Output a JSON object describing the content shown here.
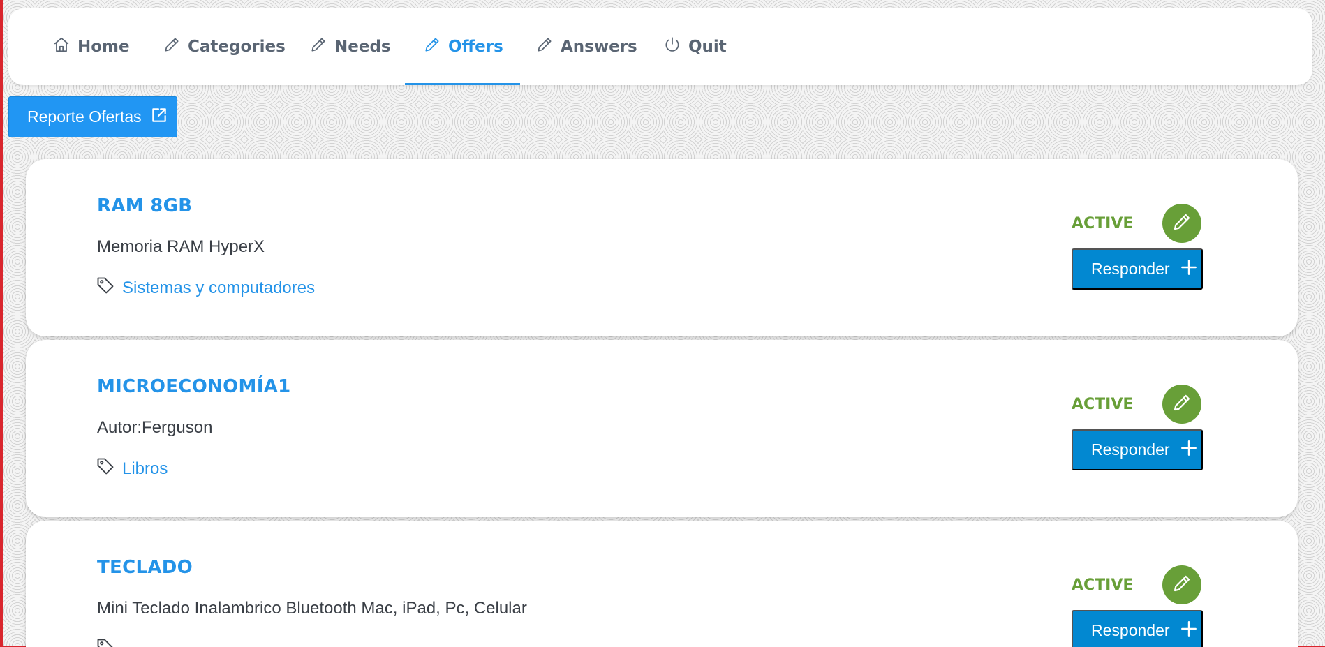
{
  "nav": {
    "items": [
      {
        "label": "Home",
        "icon": "home-icon",
        "active": false
      },
      {
        "label": "Categories",
        "icon": "pencil-icon",
        "active": false
      },
      {
        "label": "Needs",
        "icon": "pencil-icon",
        "active": false
      },
      {
        "label": "Offers",
        "icon": "pencil-icon",
        "active": true
      },
      {
        "label": "Answers",
        "icon": "pencil-icon",
        "active": false
      },
      {
        "label": "Quit",
        "icon": "power-icon",
        "active": false
      }
    ]
  },
  "report": {
    "label": "Reporte Ofertas",
    "icon": "external-link-icon"
  },
  "offers": [
    {
      "title": "RAM 8GB",
      "description": "Memoria RAM HyperX",
      "category": "Sistemas y computadores",
      "status": "ACTIVE",
      "respond_label": "Responder"
    },
    {
      "title": "MICROECONOMÍA1",
      "description": "Autor:Ferguson",
      "category": "Libros",
      "status": "ACTIVE",
      "respond_label": "Responder"
    },
    {
      "title": "TECLADO",
      "description": "Mini Teclado Inalambrico Bluetooth Mac, iPad, Pc, Celular",
      "category": "",
      "status": "ACTIVE",
      "respond_label": "Responder"
    }
  ],
  "colors": {
    "accent": "#2493e8",
    "status_active": "#689f38",
    "respond_button": "#0288d1",
    "report_button": "#2196f3",
    "nav_text": "#5a6573",
    "frame_edge": "#d9262e"
  }
}
